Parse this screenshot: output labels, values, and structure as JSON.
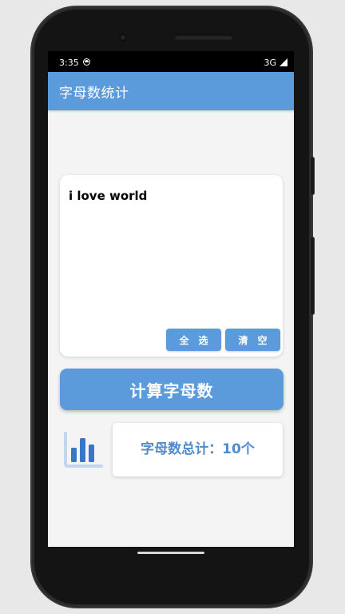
{
  "status_bar": {
    "time": "3:35",
    "network": "3G"
  },
  "app_bar": {
    "title": "字母数统计"
  },
  "input_card": {
    "text_value": "i love world",
    "select_all_label": "全选",
    "clear_label": "清空"
  },
  "calculate_button": {
    "label": "计算字母数"
  },
  "result": {
    "text": "字母数总计：10个"
  },
  "icons": {
    "sync": "sync-icon",
    "signal": "signal-icon",
    "chart": "bar-chart-icon"
  },
  "colors": {
    "primary": "#5b9bdc",
    "result_text": "#4f8ccc",
    "chart_bars": "#3a76c8",
    "chart_base": "#c3d6f0"
  }
}
